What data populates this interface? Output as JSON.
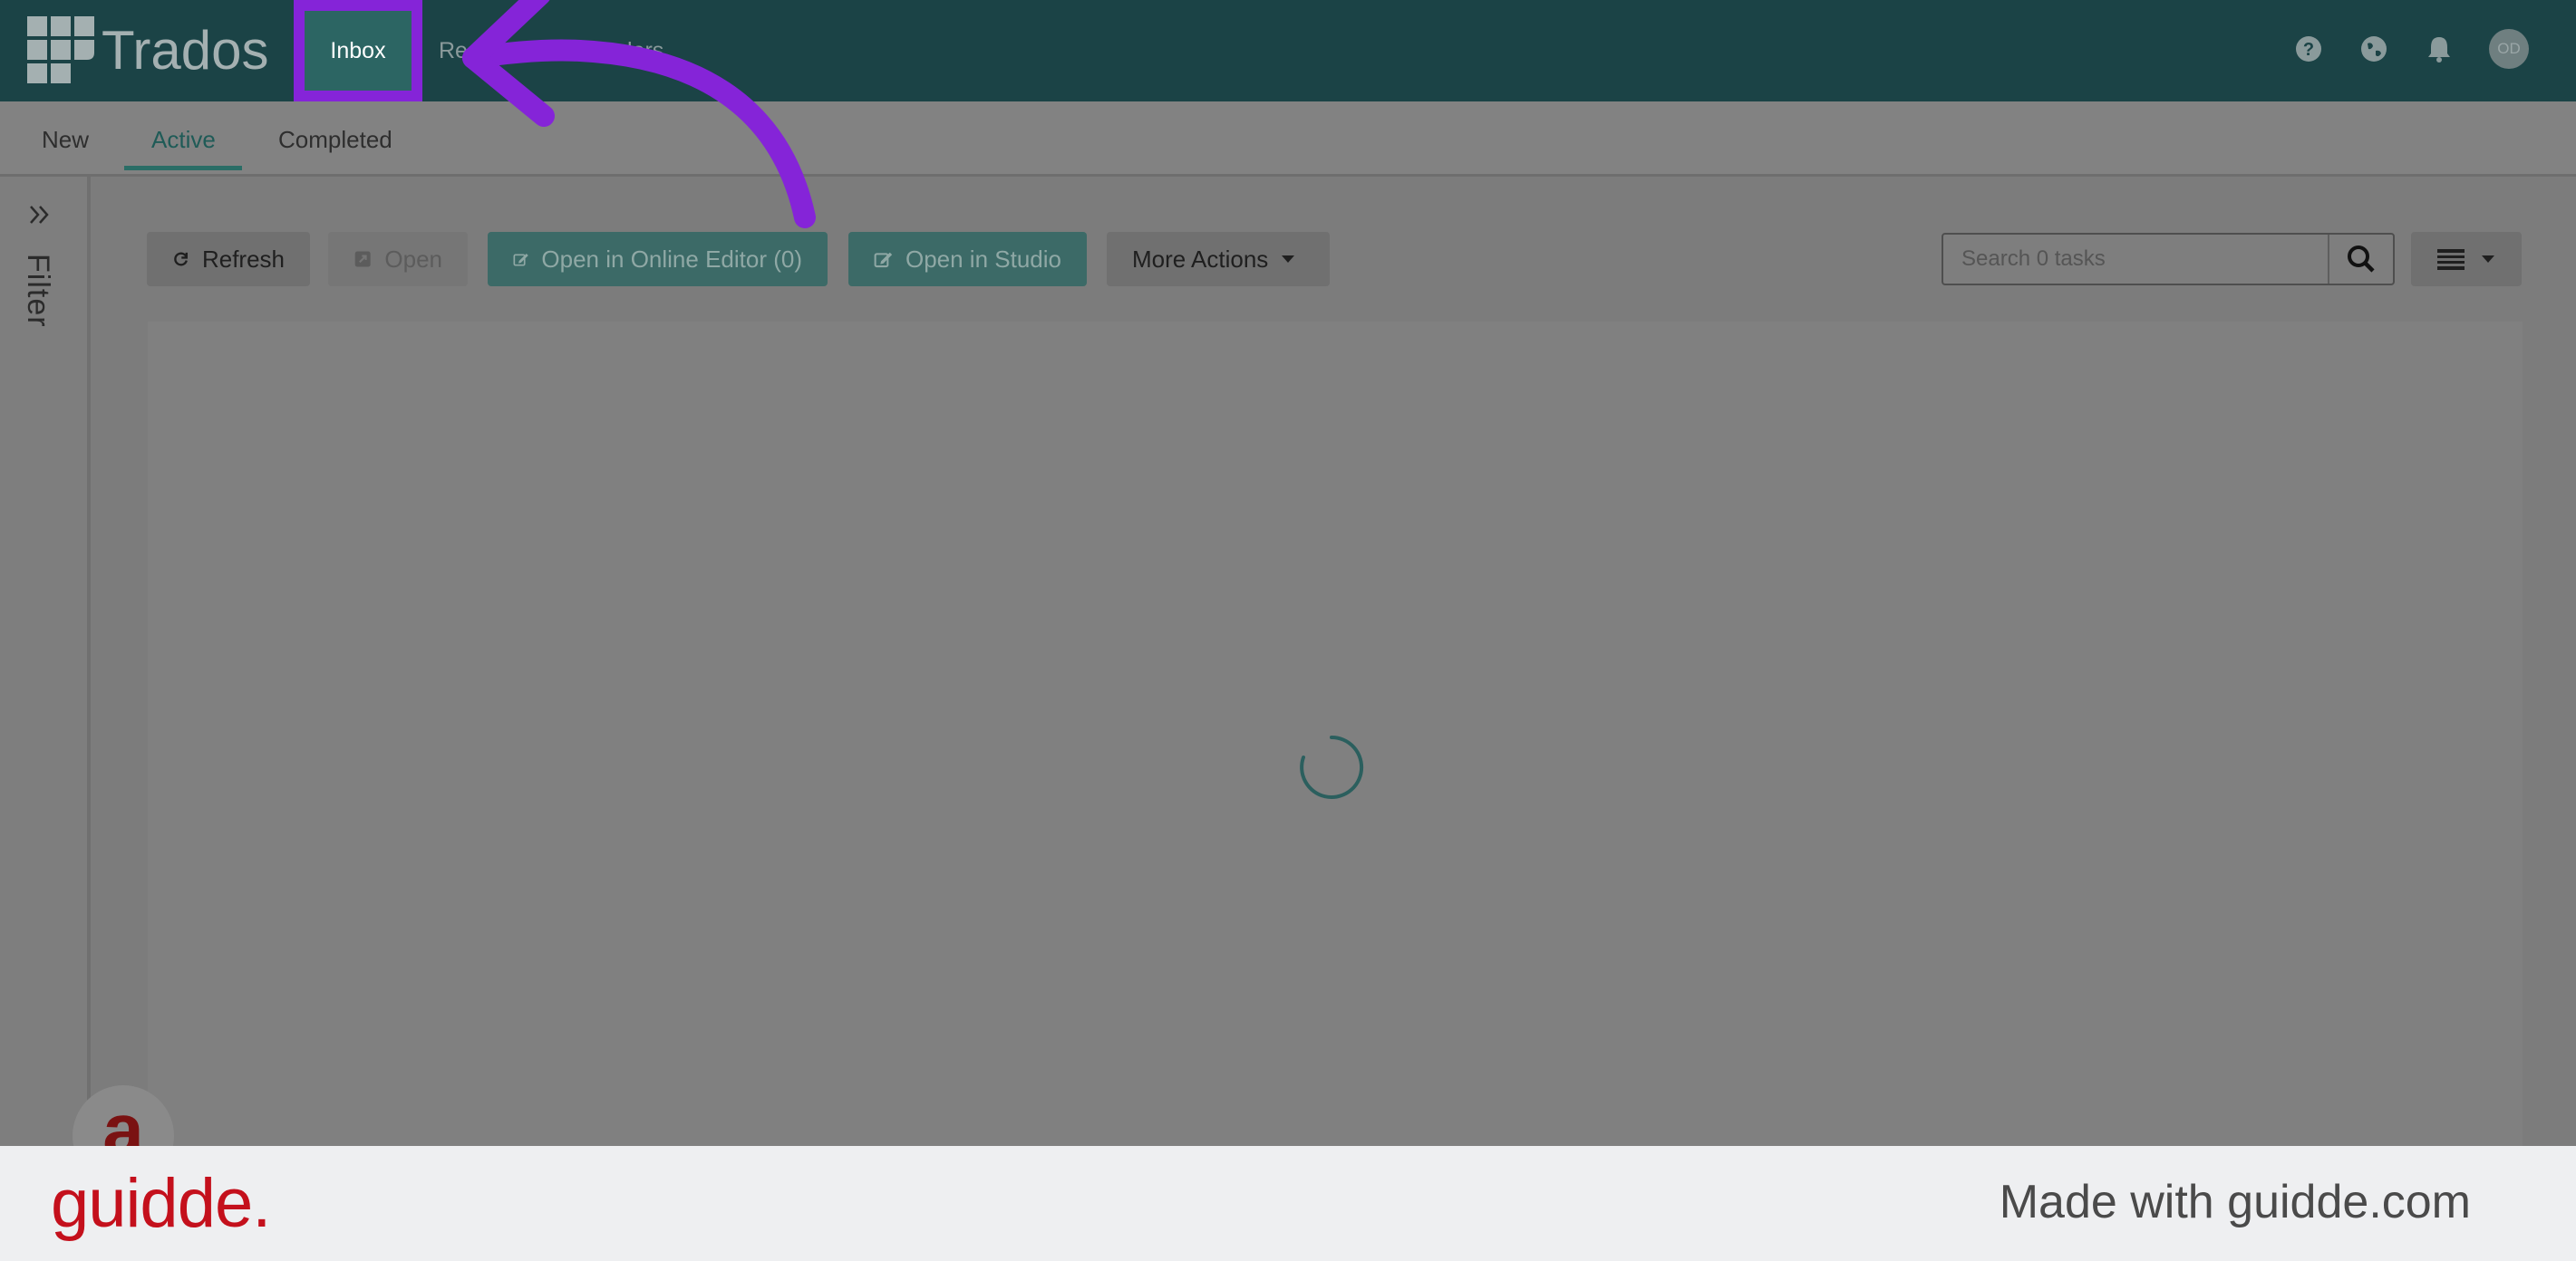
{
  "header": {
    "brand": "Trados",
    "nav": [
      {
        "label": "Inbox",
        "selected": true
      },
      {
        "label": "Res"
      },
      {
        "label": "lers"
      }
    ],
    "avatar_initials": "OD",
    "icons": [
      "help-icon",
      "globe-icon",
      "bell-icon"
    ]
  },
  "subtabs": [
    {
      "label": "New"
    },
    {
      "label": "Active",
      "selected": true
    },
    {
      "label": "Completed"
    }
  ],
  "sidebar": {
    "label": "Filter"
  },
  "toolbar": {
    "refresh": "Refresh",
    "open": "Open",
    "open_online": "Open in Online Editor (0)",
    "open_studio": "Open in Studio",
    "more_actions": "More Actions"
  },
  "search": {
    "placeholder": "Search 0 tasks"
  },
  "footer": {
    "logo": "guidde.",
    "made_with": "Made with guidde.com"
  },
  "bubble": {
    "letter": "a"
  },
  "colors": {
    "header_bg": "#1b4346",
    "accent_teal": "#2c6563",
    "highlight_purple": "#8524d8",
    "guidde_red": "#c4101c"
  }
}
